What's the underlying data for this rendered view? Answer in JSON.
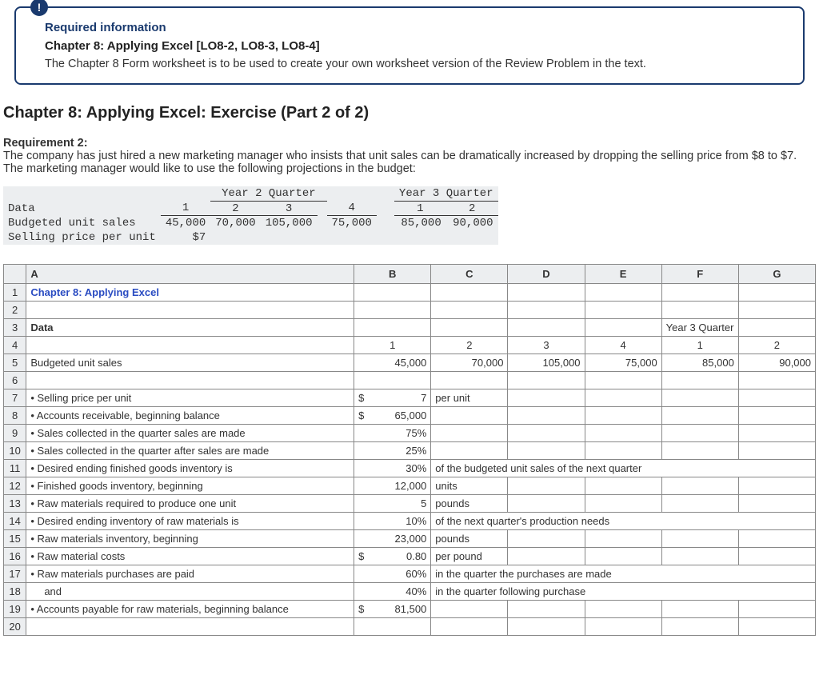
{
  "info": {
    "badge": "!",
    "required_label": "Required information",
    "chapter_bold": "Chapter 8: Applying Excel [LO8-2, LO8-3, LO8-4]",
    "desc": "The Chapter 8 Form worksheet is to be used to create your own worksheet version of the Review Problem in the text."
  },
  "section_title": "Chapter 8: Applying Excel: Exercise (Part 2 of 2)",
  "req2": {
    "label": "Requirement 2:",
    "text": "The company has just hired a new marketing manager who insists that unit sales can be dramatically increased by dropping the selling price from $8 to $7. The marketing manager would like to use the following projections in the budget:"
  },
  "proj": {
    "hdr_y2": "Year 2 Quarter",
    "hdr_y3": "Year 3 Quarter",
    "cols": [
      "1",
      "2",
      "3",
      "4",
      "1",
      "2"
    ],
    "rows": {
      "data_label": "Data",
      "bus_label": "Budgeted unit sales",
      "bus": [
        "45,000",
        "70,000",
        "105,000",
        "75,000",
        "85,000",
        "90,000"
      ],
      "spu_label": "Selling price per unit",
      "spu": "$7"
    }
  },
  "ss": {
    "cols": [
      "A",
      "B",
      "C",
      "D",
      "E",
      "F",
      "G"
    ],
    "row1": {
      "A": "Chapter 8: Applying Excel"
    },
    "row3": {
      "A": "Data",
      "F": "Year 3 Quarter"
    },
    "row4": {
      "B": "1",
      "C": "2",
      "D": "3",
      "E": "4",
      "F": "1",
      "G": "2"
    },
    "row5": {
      "A": "Budgeted unit sales",
      "B": "45,000",
      "C": "70,000",
      "D": "105,000",
      "E": "75,000",
      "F": "85,000",
      "G": "90,000"
    },
    "row7": {
      "A": "Selling price per unit",
      "B_sym": "$",
      "B_val": "7",
      "C": "per unit"
    },
    "row8": {
      "A": "Accounts receivable, beginning balance",
      "B_sym": "$",
      "B_val": "65,000"
    },
    "row9": {
      "A": "Sales collected in the quarter sales are made",
      "B_val": "75%"
    },
    "row10": {
      "A": "Sales collected in the quarter after sales are made",
      "B_val": "25%"
    },
    "row11": {
      "A": "Desired ending finished goods inventory is",
      "B_val": "30%",
      "C": "of the budgeted unit sales of the next quarter"
    },
    "row12": {
      "A": "Finished goods inventory, beginning",
      "B_val": "12,000",
      "C": "units"
    },
    "row13": {
      "A": "Raw materials required to produce one unit",
      "B_val": "5",
      "C": "pounds"
    },
    "row14": {
      "A": "Desired ending inventory of raw materials is",
      "B_val": "10%",
      "C": "of the next quarter's production needs"
    },
    "row15": {
      "A": "Raw materials inventory, beginning",
      "B_val": "23,000",
      "C": "pounds"
    },
    "row16": {
      "A": "Raw material costs",
      "B_sym": "$",
      "B_val": "0.80",
      "C": "per pound"
    },
    "row17": {
      "A": "Raw materials purchases are paid",
      "B_val": "60%",
      "C": "in the quarter the purchases are made"
    },
    "row18": {
      "A": "and",
      "B_val": "40%",
      "C": "in the quarter following purchase",
      "A_indent": "   "
    },
    "row19": {
      "A": "Accounts payable for raw materials, beginning balance",
      "B_sym": "$",
      "B_val": "81,500"
    }
  }
}
